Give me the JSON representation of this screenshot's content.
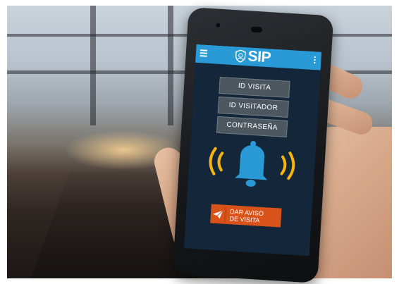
{
  "app": {
    "name": "SIP",
    "brand_color": "#2a9ad6",
    "screen_bg": "#13263a",
    "accent_color": "#d9521a",
    "bell_color": "#2a9ad6",
    "waves_color": "#f5b50c"
  },
  "appbar": {
    "logo_text": "SIP",
    "menu_icon": "hamburger-menu-icon",
    "overflow_icon": "more-vert-icon"
  },
  "form": {
    "id_visita": "ID VISITA",
    "id_visitador": "ID VISITADOR",
    "contrasena": "CONTRASEÑA"
  },
  "alert": {
    "icon": "ringing-bell-icon"
  },
  "cta": {
    "line1": "DAR AVISO",
    "line2": "DE VISITA",
    "icon": "paper-plane-icon"
  }
}
